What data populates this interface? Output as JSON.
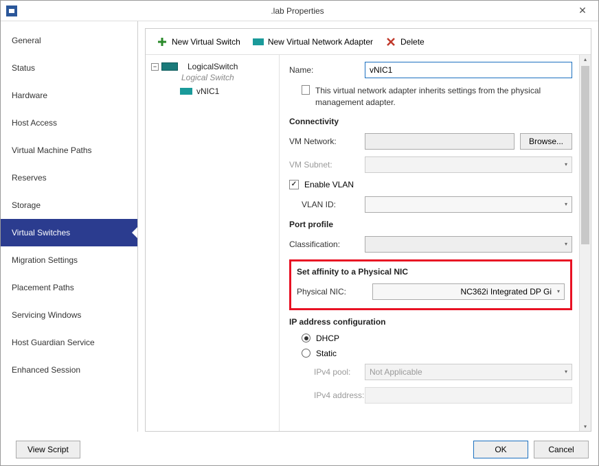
{
  "window": {
    "title": ".lab Properties"
  },
  "sidebar": {
    "items": [
      {
        "label": "General"
      },
      {
        "label": "Status"
      },
      {
        "label": "Hardware"
      },
      {
        "label": "Host Access"
      },
      {
        "label": "Virtual Machine Paths"
      },
      {
        "label": "Reserves"
      },
      {
        "label": "Storage"
      },
      {
        "label": "Virtual Switches"
      },
      {
        "label": "Migration Settings"
      },
      {
        "label": "Placement Paths"
      },
      {
        "label": "Servicing Windows"
      },
      {
        "label": "Host Guardian Service"
      },
      {
        "label": "Enhanced Session"
      }
    ],
    "selected_index": 7
  },
  "toolbar": {
    "new_switch": "New Virtual Switch",
    "new_adapter": "New Virtual Network Adapter",
    "delete": "Delete"
  },
  "tree": {
    "switch_label": "LogicalSwitch",
    "switch_sub": "Logical Switch",
    "nic_label": "vNIC1"
  },
  "form": {
    "name_label": "Name:",
    "name_value": "vNIC1",
    "inherit_text": "This virtual network adapter inherits settings from the physical management adapter.",
    "connectivity": "Connectivity",
    "vm_network_label": "VM Network:",
    "vm_network_value": "",
    "browse": "Browse...",
    "vm_subnet_label": "VM Subnet:",
    "enable_vlan": "Enable VLAN",
    "vlan_id_label": "VLAN ID:",
    "port_profile": "Port profile",
    "classification_label": "Classification:",
    "affinity": "Set affinity to a Physical NIC",
    "physical_nic_label": "Physical NIC:",
    "physical_nic_value": "NC362i Integrated DP Gi",
    "ip_config": "IP address configuration",
    "dhcp": "DHCP",
    "static": "Static",
    "ipv4_pool_label": "IPv4 pool:",
    "ipv4_pool_value": "Not Applicable",
    "ipv4_addr_label": "IPv4 address:"
  },
  "footer": {
    "view_script": "View Script",
    "ok": "OK",
    "cancel": "Cancel"
  }
}
